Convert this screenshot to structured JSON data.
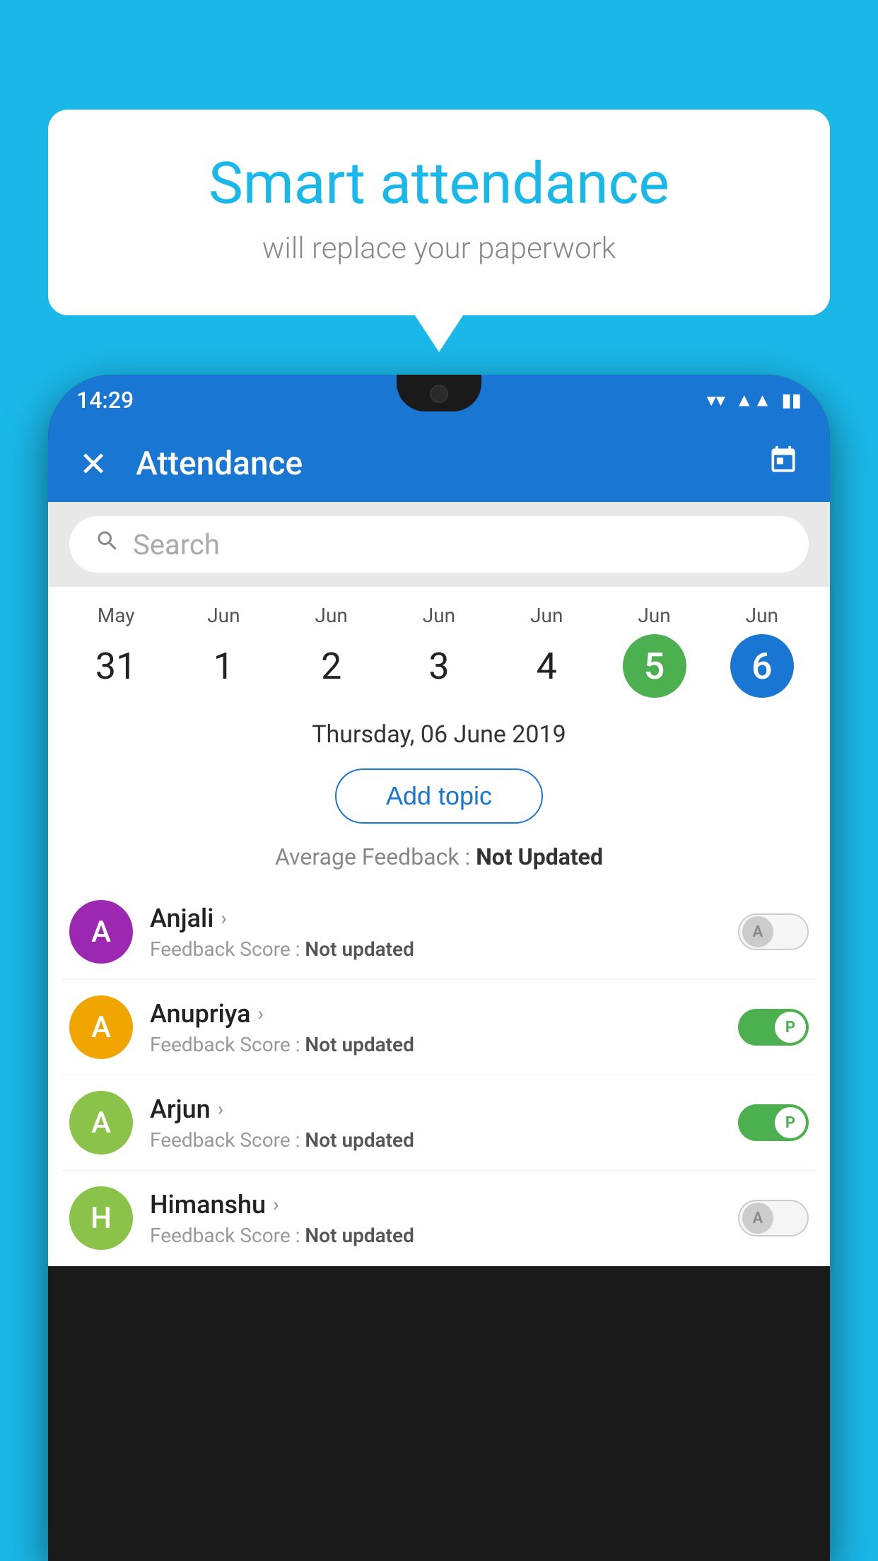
{
  "background_color": "#1ab8e8",
  "speech_bubble": {
    "title": "Smart attendance",
    "subtitle": "will replace your paperwork"
  },
  "status_bar": {
    "time": "14:29",
    "wifi": "▼",
    "signal": "▲",
    "battery": "▮"
  },
  "app_header": {
    "title": "Attendance",
    "close_icon": "✕",
    "calendar_icon": "📅"
  },
  "search": {
    "placeholder": "Search"
  },
  "calendar": {
    "dates": [
      {
        "month": "May",
        "number": "31",
        "state": "normal"
      },
      {
        "month": "Jun",
        "number": "1",
        "state": "normal"
      },
      {
        "month": "Jun",
        "number": "2",
        "state": "normal"
      },
      {
        "month": "Jun",
        "number": "3",
        "state": "normal"
      },
      {
        "month": "Jun",
        "number": "4",
        "state": "normal"
      },
      {
        "month": "Jun",
        "number": "5",
        "state": "today"
      },
      {
        "month": "Jun",
        "number": "6",
        "state": "selected"
      }
    ],
    "selected_date_label": "Thursday, 06 June 2019"
  },
  "add_topic_label": "Add topic",
  "avg_feedback_label": "Average Feedback :",
  "avg_feedback_value": "Not Updated",
  "students": [
    {
      "name": "Anjali",
      "avatar_letter": "A",
      "avatar_color": "#9c27b0",
      "feedback_label": "Feedback Score :",
      "feedback_value": "Not updated",
      "attendance_state": "off",
      "attendance_label": "A"
    },
    {
      "name": "Anupriya",
      "avatar_letter": "A",
      "avatar_color": "#f0a500",
      "feedback_label": "Feedback Score :",
      "feedback_value": "Not updated",
      "attendance_state": "on",
      "attendance_label": "P"
    },
    {
      "name": "Arjun",
      "avatar_letter": "A",
      "avatar_color": "#8bc34a",
      "feedback_label": "Feedback Score :",
      "feedback_value": "Not updated",
      "attendance_state": "on",
      "attendance_label": "P"
    },
    {
      "name": "Himanshu",
      "avatar_letter": "H",
      "avatar_color": "#8bc34a",
      "feedback_label": "Feedback Score :",
      "feedback_value": "Not updated",
      "attendance_state": "off",
      "attendance_label": "A"
    }
  ]
}
